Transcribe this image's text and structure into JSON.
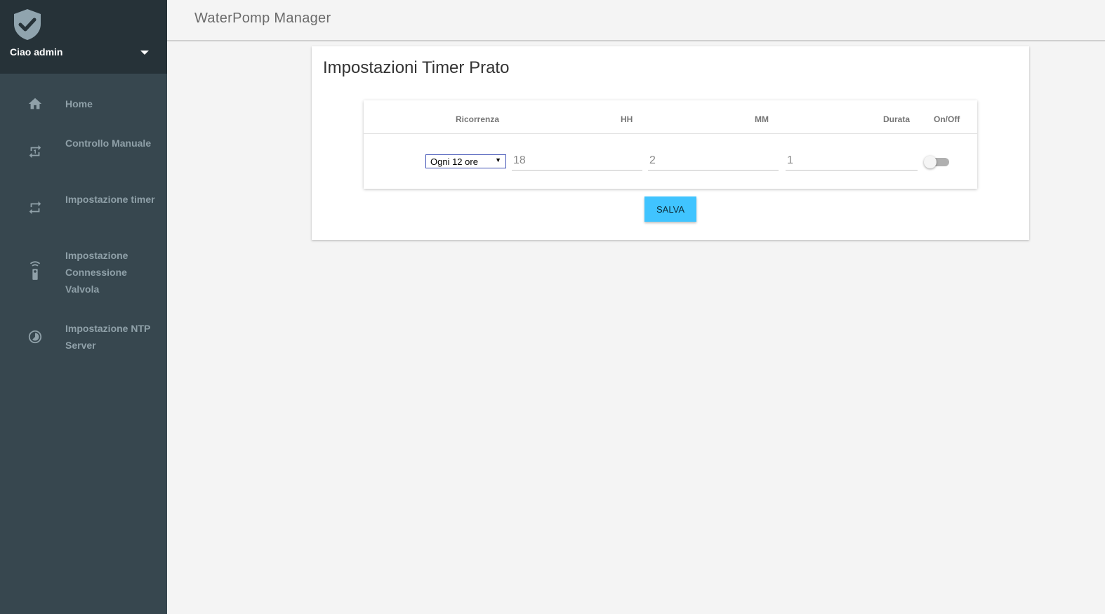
{
  "sidebar": {
    "user_greeting": "Ciao admin",
    "items": [
      {
        "label": "Home",
        "icon": "home-icon"
      },
      {
        "label": "Controllo Manuale",
        "icon": "repeat-one-icon"
      },
      {
        "label": "Impostazione timer",
        "icon": "repeat-icon"
      },
      {
        "label": "Impostazione Connessione Valvola",
        "icon": "settings-remote-icon"
      },
      {
        "label": "Impostazione NTP Server",
        "icon": "timelapse-icon"
      }
    ]
  },
  "header": {
    "app_title": "WaterPomp Manager"
  },
  "main": {
    "card_title": "Impostazioni Timer Prato",
    "table": {
      "headers": {
        "recurrence": "Ricorrenza",
        "hours": "HH",
        "minutes": "MM",
        "duration": "Durata",
        "onoff": "On/Off"
      },
      "row": {
        "recurrence": "Ogni 12 ore",
        "hours": "18",
        "minutes": "2",
        "duration": "1",
        "enabled": false
      }
    },
    "save_label": "SALVA"
  },
  "colors": {
    "sidebar_bg": "#37474f",
    "sidebar_header_bg": "#263238",
    "accent": "#40c4ff",
    "page_bg": "#f4f4f4"
  }
}
